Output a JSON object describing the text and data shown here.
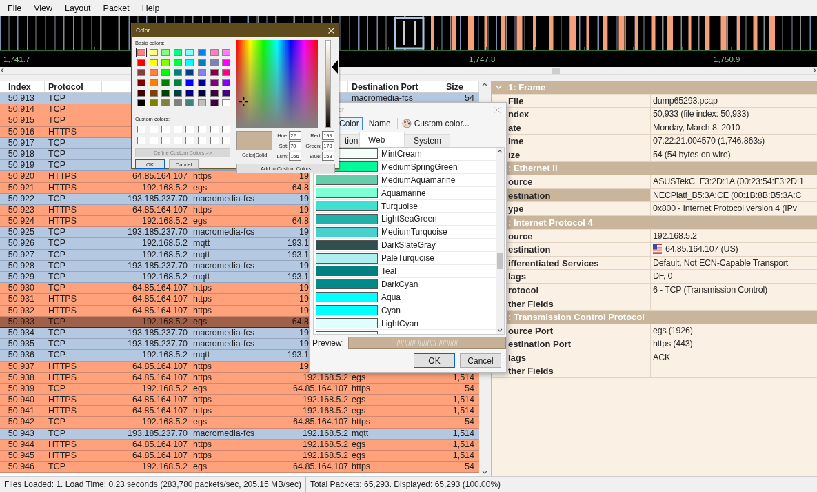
{
  "menu": [
    "File",
    "View",
    "Layout",
    "Packet",
    "Help"
  ],
  "timeline": {
    "ticks": [
      "1,741.7",
      "1,747.8",
      "1,750.9"
    ]
  },
  "packets": {
    "columns": [
      {
        "kind": "index",
        "label": "Index"
      },
      {
        "kind": "protocol",
        "label": "Protocol"
      },
      {
        "kind": "destination_port",
        "label": "Destination Port"
      },
      {
        "kind": "size",
        "label": "Size"
      }
    ],
    "rows": [
      {
        "index": "50,913",
        "protocol": "TCP",
        "destination_port": "macromedia-fcs",
        "size": "54",
        "color": "#b4c8e2",
        "selected": false
      },
      {
        "index": "50,914",
        "protocol": "TCP",
        "color": "#ffa27c",
        "selected": false
      },
      {
        "index": "50,915",
        "protocol": "TCP",
        "color": "#ffa27c",
        "selected": false
      },
      {
        "index": "50,916",
        "protocol": "HTTPS",
        "color": "#ffa27c",
        "selected": false
      },
      {
        "index": "50,917",
        "protocol": "TCP",
        "color": "#b4c8e2",
        "selected": false
      },
      {
        "index": "50,918",
        "protocol": "TCP",
        "color": "#b4c8e2",
        "selected": false
      },
      {
        "index": "50,919",
        "protocol": "TCP",
        "color": "#b4c8e2",
        "selected": false
      },
      {
        "index": "50,920",
        "protocol": "HTTPS",
        "source": "64.85.164.107",
        "source_port": "https",
        "destination_cut": "19",
        "color": "#ffa27c",
        "selected": false
      },
      {
        "index": "50,921",
        "protocol": "HTTPS",
        "source": "192.168.5.2",
        "source_port": "egs",
        "destination_cut": "64.8",
        "color": "#ffa27c",
        "selected": false
      },
      {
        "index": "50,922",
        "protocol": "TCP",
        "source": "193.185.237.70",
        "source_port": "macromedia-fcs",
        "destination_cut": "19",
        "color": "#b4c8e2",
        "selected": false
      },
      {
        "index": "50,923",
        "protocol": "HTTPS",
        "source": "64.85.164.107",
        "source_port": "https",
        "destination_cut": "19",
        "color": "#ffa27c",
        "selected": false
      },
      {
        "index": "50,924",
        "protocol": "HTTPS",
        "source": "192.168.5.2",
        "source_port": "egs",
        "destination_cut": "64.8",
        "color": "#ffa27c",
        "selected": false
      },
      {
        "index": "50,925",
        "protocol": "TCP",
        "source": "193.185.237.70",
        "source_port": "macromedia-fcs",
        "destination_cut": "19",
        "color": "#b4c8e2",
        "selected": false
      },
      {
        "index": "50,926",
        "protocol": "TCP",
        "source": "192.168.5.2",
        "source_port": "mqtt",
        "destination_cut": "193.1",
        "color": "#b4c8e2",
        "selected": false
      },
      {
        "index": "50,927",
        "protocol": "TCP",
        "source": "192.168.5.2",
        "source_port": "mqtt",
        "destination_cut": "193.1",
        "color": "#b4c8e2",
        "selected": false
      },
      {
        "index": "50,928",
        "protocol": "TCP",
        "source": "193.185.237.70",
        "source_port": "macromedia-fcs",
        "destination_cut": "19",
        "color": "#b4c8e2",
        "selected": false
      },
      {
        "index": "50,929",
        "protocol": "TCP",
        "source": "192.168.5.2",
        "source_port": "mqtt",
        "destination_cut": "193.1",
        "color": "#b4c8e2",
        "selected": false
      },
      {
        "index": "50,930",
        "protocol": "TCP",
        "source": "64.85.164.107",
        "source_port": "https",
        "destination_cut": "19",
        "color": "#ffa27c",
        "selected": false
      },
      {
        "index": "50,931",
        "protocol": "HTTPS",
        "source": "64.85.164.107",
        "source_port": "https",
        "destination_cut": "19",
        "color": "#ffa27c",
        "selected": false
      },
      {
        "index": "50,932",
        "protocol": "HTTPS",
        "source": "64.85.164.107",
        "source_port": "https",
        "destination_cut": "19",
        "color": "#ffa27c",
        "selected": false
      },
      {
        "index": "50,933",
        "protocol": "TCP",
        "source": "192.168.5.2",
        "source_port": "egs",
        "destination_cut": "64.8",
        "selected": true
      },
      {
        "index": "50,934",
        "protocol": "TCP",
        "source": "193.185.237.70",
        "source_port": "macromedia-fcs",
        "destination_cut": "19",
        "color": "#b4c8e2",
        "selected": false
      },
      {
        "index": "50,935",
        "protocol": "TCP",
        "source": "193.185.237.70",
        "source_port": "macromedia-fcs",
        "destination_cut": "19",
        "color": "#b4c8e2",
        "selected": false
      },
      {
        "index": "50,936",
        "protocol": "TCP",
        "source": "192.168.5.2",
        "source_port": "mqtt",
        "destination_cut": "193.1",
        "color": "#b4c8e2",
        "selected": false
      },
      {
        "index": "50,937",
        "protocol": "HTTPS",
        "source": "64.85.164.107",
        "source_port": "https",
        "destination_cut": "19",
        "color": "#ffa27c",
        "selected": false
      },
      {
        "index": "50,938",
        "protocol": "HTTPS",
        "source": "64.85.164.107",
        "source_port": "https",
        "destination": "192.168.5.2",
        "destination_port": "egs",
        "size": "1,514",
        "color": "#ffa27c",
        "selected": false
      },
      {
        "index": "50,939",
        "protocol": "TCP",
        "source": "192.168.5.2",
        "source_port": "egs",
        "destination": "64.85.164.107",
        "destination_port": "https",
        "size": "54",
        "color": "#ffa27c",
        "selected": false
      },
      {
        "index": "50,940",
        "protocol": "HTTPS",
        "source": "64.85.164.107",
        "source_port": "https",
        "destination": "192.168.5.2",
        "destination_port": "egs",
        "size": "1,514",
        "color": "#ffa27c",
        "selected": false
      },
      {
        "index": "50,941",
        "protocol": "HTTPS",
        "source": "64.85.164.107",
        "source_port": "https",
        "destination": "192.168.5.2",
        "destination_port": "egs",
        "size": "1,514",
        "color": "#ffa27c",
        "selected": false
      },
      {
        "index": "50,942",
        "protocol": "TCP",
        "source": "192.168.5.2",
        "source_port": "egs",
        "destination": "64.85.164.107",
        "destination_port": "https",
        "size": "54",
        "color": "#ffa27c",
        "selected": false
      },
      {
        "index": "50,943",
        "protocol": "TCP",
        "source": "193.185.237.70",
        "source_port": "macromedia-fcs",
        "destination": "192.168.5.2",
        "destination_port": "mqtt",
        "size": "1,514",
        "color": "#b4c8e2",
        "selected": false
      },
      {
        "index": "50,944",
        "protocol": "HTTPS",
        "source": "64.85.164.107",
        "source_port": "https",
        "destination": "192.168.5.2",
        "destination_port": "egs",
        "size": "1,514",
        "color": "#ffa27c",
        "selected": false
      },
      {
        "index": "50,945",
        "protocol": "HTTPS",
        "source": "64.85.164.107",
        "source_port": "https",
        "destination": "192.168.5.2",
        "destination_port": "egs",
        "size": "1,514",
        "color": "#ffa27c",
        "selected": false
      },
      {
        "index": "50,946",
        "protocol": "TCP",
        "source": "192.168.5.2",
        "source_port": "egs",
        "destination": "64.85.164.107",
        "destination_port": "https",
        "size": "54",
        "color": "#ffa27c",
        "selected": false
      }
    ]
  },
  "details": {
    "sections": [
      {
        "title": "1: Frame",
        "expanded": true,
        "fields": [
          {
            "kind": "text",
            "label": "File",
            "value": "dump65293.pcap",
            "selected": false
          },
          {
            "kind": "text",
            "label": "ndex",
            "value": "50,933 (file index: 50,933)",
            "selected": false
          },
          {
            "kind": "text",
            "label": "ate",
            "value": "Monday, March 8, 2010",
            "selected": false
          },
          {
            "kind": "text",
            "label": "ime",
            "value": "07:22:21.004570 (1,746.863s)",
            "selected": false
          },
          {
            "kind": "text",
            "label": "ize",
            "value": "54 (54 bytes on wire)",
            "selected": false
          }
        ]
      },
      {
        "title": ": Ethernet II",
        "fields": [
          {
            "kind": "text",
            "label": "ource",
            "value": "ASUSTekC_F3:2D:1A (00:23:54:F3:2D:1",
            "selected": false
          },
          {
            "kind": "text",
            "label": "estination",
            "value": "NECPlatf_B5:3A:CE (00:1B:8B:B5:3A:C",
            "selected": true
          },
          {
            "kind": "text",
            "label": "ype",
            "value": "0x800 - Internet Protocol version 4 (IPv",
            "selected": false
          }
        ]
      },
      {
        "title": ": Internet Protocol 4",
        "fields": [
          {
            "kind": "text",
            "label": "ource",
            "value": "192.168.5.2",
            "selected": false
          },
          {
            "kind": "flag",
            "label": "estination",
            "value": "64.85.164.107 (US)",
            "selected": false
          },
          {
            "kind": "text",
            "label": "ifferentiated Services",
            "value": "Default, Not ECN-Capable Transport",
            "selected": false
          },
          {
            "kind": "text",
            "label": "lags",
            "value": "DF, 0",
            "selected": false
          },
          {
            "kind": "text",
            "label": "rotocol",
            "value": "6 - TCP (Transmission Control)",
            "selected": false
          },
          {
            "kind": "text",
            "label": "ther Fields",
            "selected": false
          }
        ]
      },
      {
        "title": ": Transmission Control Protocol",
        "fields": [
          {
            "kind": "text",
            "label": "ource Port",
            "value": "egs (1926)",
            "selected": false
          },
          {
            "kind": "text",
            "label": "estination Port",
            "value": "https (443)",
            "selected": false
          },
          {
            "kind": "text",
            "label": "lags",
            "value": "ACK",
            "selected": false
          },
          {
            "kind": "text",
            "label": "ther Fields",
            "selected": false
          }
        ]
      }
    ]
  },
  "status_bar": [
    "Files Loaded: 1. Load Time: 0.23 seconds (283,780 packets/sec, 205.15 MB/sec)",
    "Total Packets: 65,293. Displayed: 65,293 (100.00%)"
  ],
  "color_picker": {
    "title": "er",
    "toolbar": [
      {
        "label": "Color",
        "selected": true
      },
      {
        "label": "Name",
        "selected": false
      }
    ],
    "custom_button": "Custom color...",
    "tabs": [
      {
        "label": "tion",
        "selected": false
      },
      {
        "label": "Web",
        "selected": true
      },
      {
        "label": "System",
        "selected": false
      }
    ],
    "colors": [
      {
        "name": "MintCream",
        "color": "#f5fffa"
      },
      {
        "name": "MediumSpringGreen",
        "color": "#00fa9a"
      },
      {
        "name": "MediumAquamarine",
        "color": "#66cdaa"
      },
      {
        "name": "Aquamarine",
        "color": "#7fffd4"
      },
      {
        "name": "Turquoise",
        "color": "#40e0d0"
      },
      {
        "name": "LightSeaGreen",
        "color": "#20b2aa"
      },
      {
        "name": "MediumTurquoise",
        "color": "#48d1cc"
      },
      {
        "name": "DarkSlateGray",
        "color": "#2f4f4f"
      },
      {
        "name": "PaleTurquoise",
        "color": "#afeeee"
      },
      {
        "name": "Teal",
        "color": "#008080"
      },
      {
        "name": "DarkCyan",
        "color": "#008b8b"
      },
      {
        "name": "Aqua",
        "color": "#00ffff"
      },
      {
        "name": "Cyan",
        "color": "#00ffff"
      },
      {
        "name": "LightCyan",
        "color": "#e0ffff"
      },
      {
        "color": "#f0ffff"
      }
    ],
    "preview_label": "Preview:",
    "preview_text": "##### ##### #####",
    "ok": "OK",
    "cancel": "Cancel"
  },
  "color_dialog": {
    "title": "Color",
    "basic_label": "Basic colors:",
    "basic_colors": [
      {
        "color": "#ff8080",
        "selected": true
      },
      {
        "color": "#ffff80",
        "selected": false
      },
      {
        "color": "#80ff80",
        "selected": false
      },
      {
        "color": "#00ff80",
        "selected": false
      },
      {
        "color": "#80ffff",
        "selected": false
      },
      {
        "color": "#0080ff",
        "selected": false
      },
      {
        "color": "#ff80c0",
        "selected": false
      },
      {
        "color": "#ff80ff",
        "selected": false
      },
      {
        "color": "#ff0000",
        "selected": false
      },
      {
        "color": "#ffff00",
        "selected": false
      },
      {
        "color": "#80ff00",
        "selected": false
      },
      {
        "color": "#00ff40",
        "selected": false
      },
      {
        "color": "#00ffff",
        "selected": false
      },
      {
        "color": "#0080c0",
        "selected": false
      },
      {
        "color": "#8080c0",
        "selected": false
      },
      {
        "color": "#ff00ff",
        "selected": false
      },
      {
        "color": "#804040",
        "selected": false
      },
      {
        "color": "#ff8040",
        "selected": false
      },
      {
        "color": "#00ff00",
        "selected": false
      },
      {
        "color": "#008080",
        "selected": false
      },
      {
        "color": "#004080",
        "selected": false
      },
      {
        "color": "#8080ff",
        "selected": false
      },
      {
        "color": "#800040",
        "selected": false
      },
      {
        "color": "#ff0080",
        "selected": false
      },
      {
        "color": "#800000",
        "selected": false
      },
      {
        "color": "#ff8000",
        "selected": false
      },
      {
        "color": "#008000",
        "selected": false
      },
      {
        "color": "#008040",
        "selected": false
      },
      {
        "color": "#0000ff",
        "selected": false
      },
      {
        "color": "#0000a0",
        "selected": false
      },
      {
        "color": "#800080",
        "selected": false
      },
      {
        "color": "#8000ff",
        "selected": false
      },
      {
        "color": "#400000",
        "selected": false
      },
      {
        "color": "#804000",
        "selected": false
      },
      {
        "color": "#004000",
        "selected": false
      },
      {
        "color": "#004040",
        "selected": false
      },
      {
        "color": "#000080",
        "selected": false
      },
      {
        "color": "#000040",
        "selected": false
      },
      {
        "color": "#400040",
        "selected": false
      },
      {
        "color": "#400080",
        "selected": false
      },
      {
        "color": "#000000",
        "selected": false
      },
      {
        "color": "#808000",
        "selected": false
      },
      {
        "color": "#808040",
        "selected": false
      },
      {
        "color": "#808080",
        "selected": false
      },
      {
        "color": "#408080",
        "selected": false
      },
      {
        "color": "#c0c0c0",
        "selected": false
      },
      {
        "color": "#400040",
        "selected": false
      },
      {
        "color": "#ffffff",
        "selected": false
      }
    ],
    "custom_label": "Custom colors:",
    "custom_colors": [
      {
        "color": "#ffffff"
      },
      {
        "color": "#ffffff"
      },
      {
        "color": "#ffffff"
      },
      {
        "color": "#ffffff"
      },
      {
        "color": "#ffffff"
      },
      {
        "color": "#ffffff"
      },
      {
        "color": "#ffffff"
      },
      {
        "color": "#ffffff"
      },
      {
        "color": "#ffffff"
      },
      {
        "color": "#ffffff"
      },
      {
        "color": "#ffffff"
      },
      {
        "color": "#ffffff"
      },
      {
        "color": "#ffffff"
      },
      {
        "color": "#ffffff"
      },
      {
        "color": "#ffffff"
      },
      {
        "color": "#ffffff"
      }
    ],
    "define_button": {
      "label": "Define Custom Colors >>",
      "disabled": true
    },
    "ok": "OK",
    "cancel": "Cancel",
    "preview_label": "Color|Solid",
    "fields": [
      {
        "label": "Hue:",
        "value": "22"
      },
      {
        "label": "Red:",
        "value": "199"
      },
      {
        "label": "Sat:",
        "value": "70"
      },
      {
        "label": "Green:",
        "value": "178"
      },
      {
        "label": "Lum:",
        "value": "166"
      },
      {
        "label": "Blue:",
        "value": "153"
      }
    ],
    "add_button": "Add to Custom Colors"
  }
}
